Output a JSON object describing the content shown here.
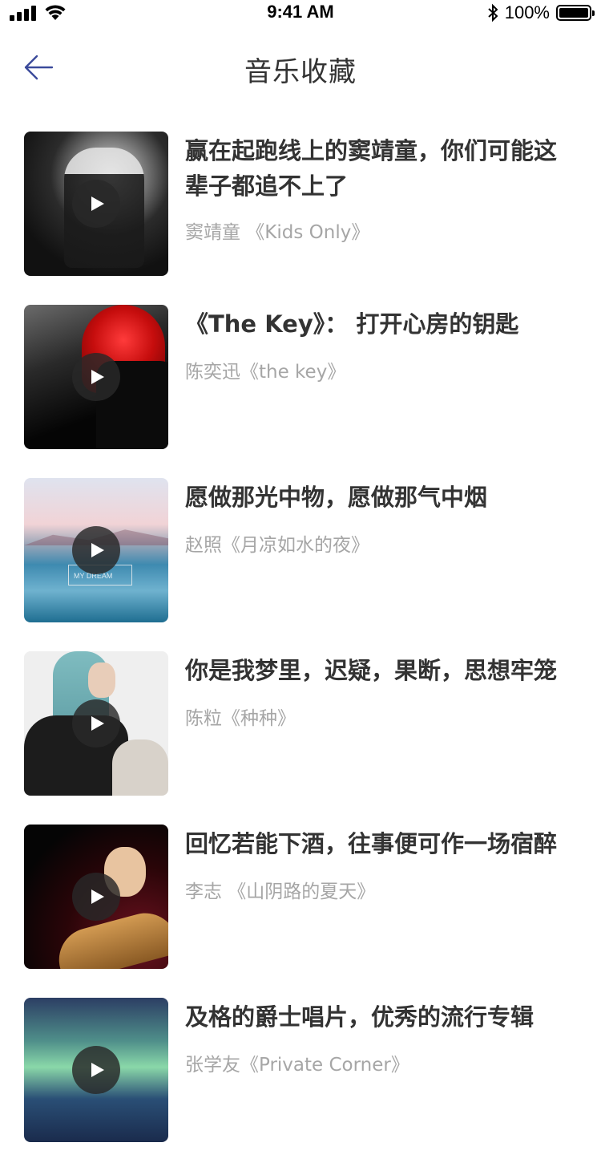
{
  "status_bar": {
    "time": "9:41 AM",
    "battery_percent": "100%",
    "icons": [
      "signal-icon",
      "wifi-icon",
      "bluetooth-icon",
      "battery-icon"
    ]
  },
  "nav": {
    "title": "音乐收藏",
    "back_icon": "arrow-left-icon",
    "accent_color": "#3b4a9b"
  },
  "items": [
    {
      "title": "赢在起跑线上的窦靖童，你们可能这辈子都追不上了",
      "subtitle": "窦靖童 《Kids Only》"
    },
    {
      "title": "《The Key》： 打开心房的钥匙",
      "subtitle": "陈奕迅《the key》"
    },
    {
      "title": "愿做那光中物，愿做那气中烟",
      "subtitle": "赵照《月凉如水的夜》"
    },
    {
      "title": "你是我梦里，迟疑，果断，思想牢笼",
      "subtitle": "陈粒《种种》"
    },
    {
      "title": "回忆若能下酒，往事便可作一场宿醉",
      "subtitle": "李志 《山阴路的夏天》"
    },
    {
      "title": "及格的爵士唱片，优秀的流行专辑",
      "subtitle": "张学友《Private Corner》"
    }
  ],
  "thumb_sign_text": "MY DREAM"
}
